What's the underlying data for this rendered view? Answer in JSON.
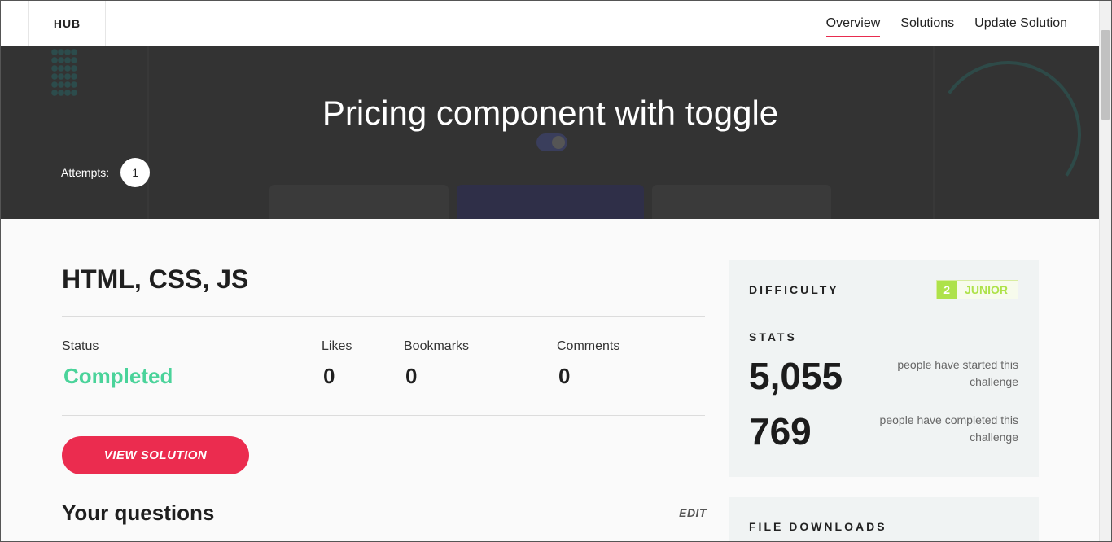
{
  "nav": {
    "brand": "HUB",
    "links": [
      {
        "label": "Overview",
        "active": true
      },
      {
        "label": "Solutions",
        "active": false
      },
      {
        "label": "Update Solution",
        "active": false
      }
    ]
  },
  "hero": {
    "title": "Pricing component with toggle",
    "attempts_label": "Attempts:",
    "attempts_count": "1"
  },
  "solution": {
    "stack": "HTML, CSS, JS",
    "stats": [
      {
        "label": "Status",
        "value": "Completed"
      },
      {
        "label": "Likes",
        "value": "0"
      },
      {
        "label": "Bookmarks",
        "value": "0"
      },
      {
        "label": "Comments",
        "value": "0"
      }
    ],
    "view_button": "VIEW SOLUTION",
    "questions_title": "Your questions",
    "edit_label": "EDIT"
  },
  "sidebar": {
    "difficulty_heading": "DIFFICULTY",
    "difficulty_level": "2",
    "difficulty_label": "JUNIOR",
    "stats_heading": "STATS",
    "started_count": "5,055",
    "started_desc": "people have started this challenge",
    "completed_count": "769",
    "completed_desc": "people have completed this challenge",
    "downloads_heading": "FILE DOWNLOADS"
  },
  "colors": {
    "accent_red": "#eb2c4f",
    "completed_green": "#4ad39a",
    "junior_green": "#aee24a",
    "hero_bg": "#333333"
  }
}
